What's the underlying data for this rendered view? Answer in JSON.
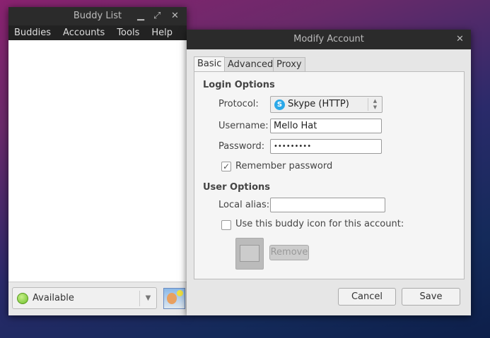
{
  "buddy_list": {
    "title": "Buddy List",
    "menu": [
      "Buddies",
      "Accounts",
      "Tools",
      "Help"
    ],
    "status": "Available"
  },
  "modify_account": {
    "title": "Modify Account",
    "tabs": [
      "Basic",
      "Advanced",
      "Proxy"
    ],
    "login_options": {
      "heading": "Login Options",
      "protocol_label": "Protocol:",
      "protocol_value": "Skype (HTTP)",
      "username_label": "Username:",
      "username_value": "Mello Hat",
      "password_label": "Password:",
      "password_value": "•••••••••",
      "remember_label": "Remember password",
      "remember_checked": true
    },
    "user_options": {
      "heading": "User Options",
      "alias_label": "Local alias:",
      "alias_value": "",
      "buddy_icon_label": "Use this buddy icon for this account:",
      "buddy_icon_checked": false,
      "remove_label": "Remove"
    },
    "cancel_label": "Cancel",
    "save_label": "Save"
  }
}
